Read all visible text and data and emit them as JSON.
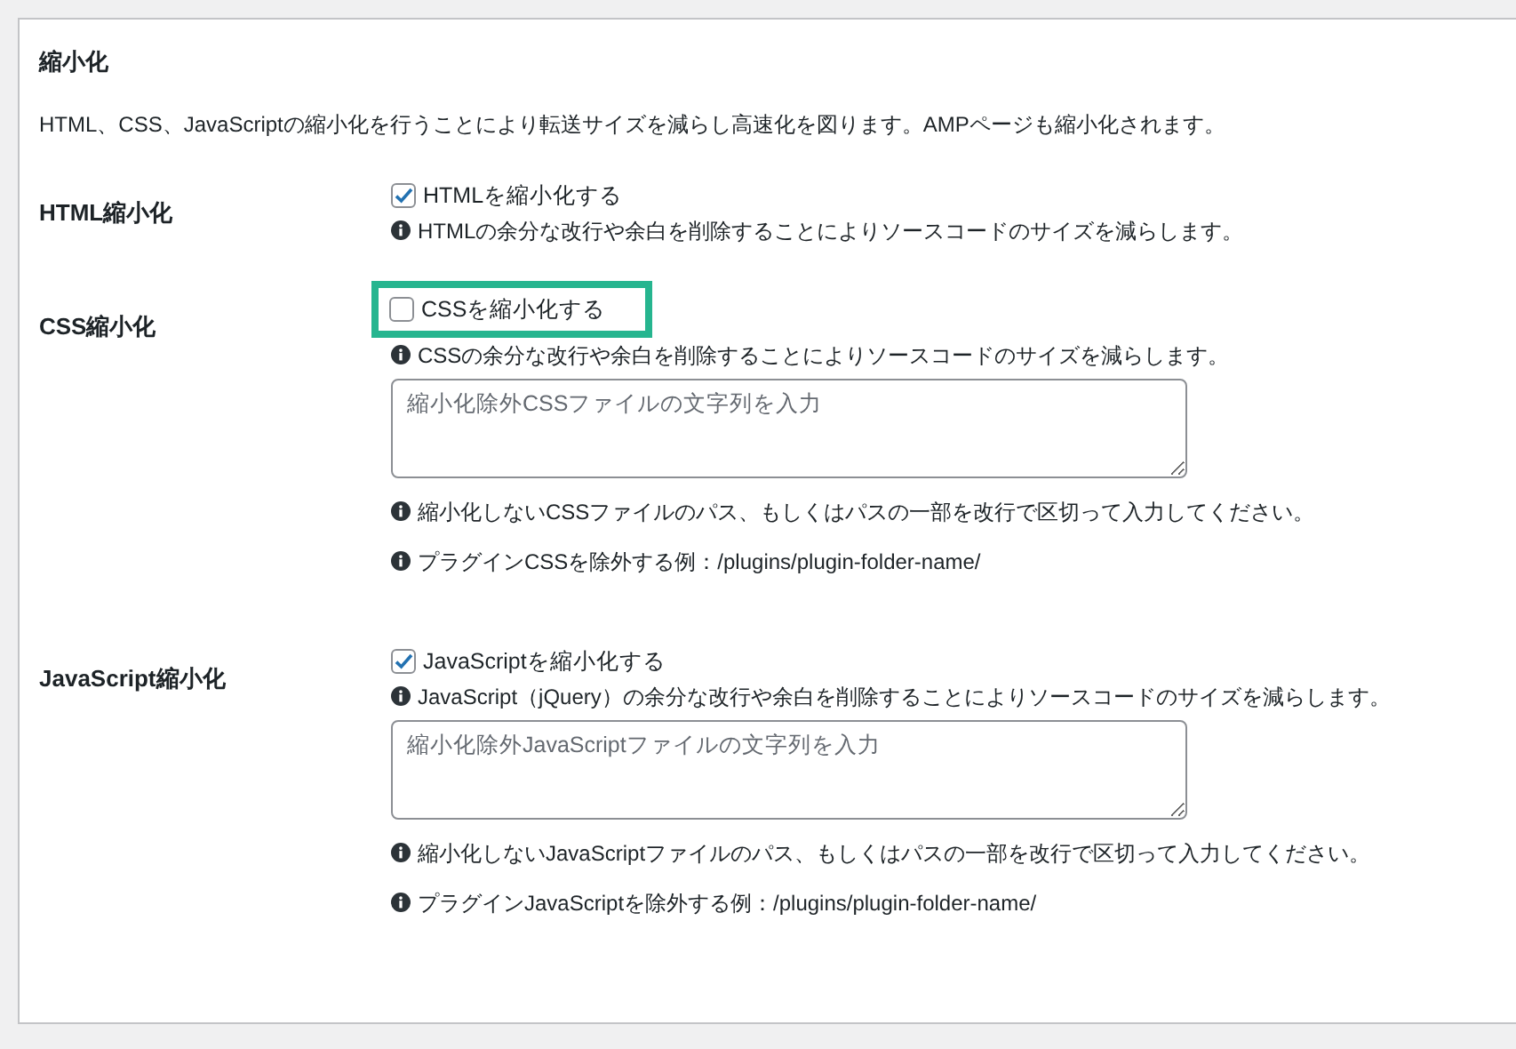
{
  "section_title": "縮小化",
  "section_description": "HTML、CSS、JavaScriptの縮小化を行うことにより転送サイズを減らし高速化を図ります。AMPページも縮小化されます。",
  "settings": [
    {
      "label": "HTML縮小化",
      "checkbox": {
        "label": "HTMLを縮小化する",
        "checked": true,
        "highlighted": false
      },
      "description": "HTMLの余分な改行や余白を削除することによりソースコードのサイズを減らします。"
    },
    {
      "label": "CSS縮小化",
      "checkbox": {
        "label": "CSSを縮小化する",
        "checked": false,
        "highlighted": true
      },
      "description": "CSSの余分な改行や余白を削除することによりソースコードのサイズを減らします。",
      "textarea": {
        "placeholder": "縮小化除外CSSファイルの文字列を入力"
      },
      "notes": [
        "縮小化しないCSSファイルのパス、もしくはパスの一部を改行で区切って入力してください。",
        "プラグインCSSを除外する例：/plugins/plugin-folder-name/"
      ]
    },
    {
      "label": "JavaScript縮小化",
      "checkbox": {
        "label": "JavaScriptを縮小化する",
        "checked": true,
        "highlighted": false
      },
      "description": "JavaScript（jQuery）の余分な改行や余白を削除することによりソースコードのサイズを減らします。",
      "textarea": {
        "placeholder": "縮小化除外JavaScriptファイルの文字列を入力"
      },
      "notes": [
        "縮小化しないJavaScriptファイルのパス、もしくはパスの一部を改行で区切って入力してください。",
        "プラグインJavaScriptを除外する例：/plugins/plugin-folder-name/"
      ]
    }
  ]
}
